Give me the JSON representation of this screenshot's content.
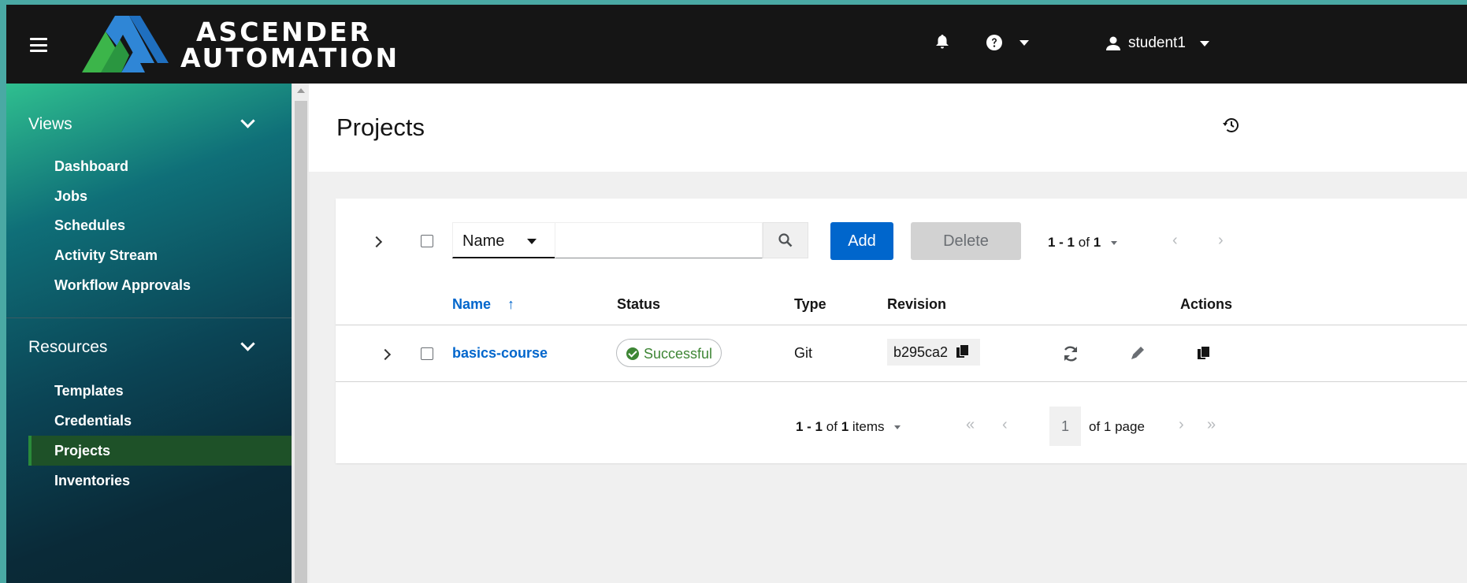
{
  "header": {
    "brand_line1": "ASCENDER",
    "brand_line2": "AUTOMATION",
    "username": "student1"
  },
  "sidebar": {
    "groups": [
      {
        "title": "Views",
        "items": [
          "Dashboard",
          "Jobs",
          "Schedules",
          "Activity Stream",
          "Workflow Approvals"
        ]
      },
      {
        "title": "Resources",
        "items": [
          "Templates",
          "Credentials",
          "Projects",
          "Inventories"
        ]
      }
    ],
    "active_item": "Projects"
  },
  "page": {
    "title": "Projects"
  },
  "toolbar": {
    "search_attribute": "Name",
    "search_value": "",
    "add_label": "Add",
    "delete_label": "Delete",
    "pagination_range": "1 - 1",
    "pagination_of": "of",
    "pagination_total": "1"
  },
  "table": {
    "columns": [
      "Name",
      "Status",
      "Type",
      "Revision",
      "Actions"
    ],
    "sort_indicator": "↑",
    "rows": [
      {
        "name": "basics-course",
        "status": "Successful",
        "type": "Git",
        "revision": "b295ca2"
      }
    ]
  },
  "footer_pagination": {
    "range": "1 - 1",
    "of_total": "of",
    "total": "1",
    "items_label": "items",
    "current_page": "1",
    "pages_label": "of 1 page"
  },
  "colors": {
    "header_bg": "#151515",
    "primary": "#0066cc",
    "success": "#3e8635",
    "sidebar_active": "#1e5128"
  },
  "icons": [
    "hamburger-icon",
    "bell-icon",
    "help-icon",
    "user-icon",
    "history-icon",
    "search-icon",
    "sync-icon",
    "edit-icon",
    "copy-icon"
  ]
}
